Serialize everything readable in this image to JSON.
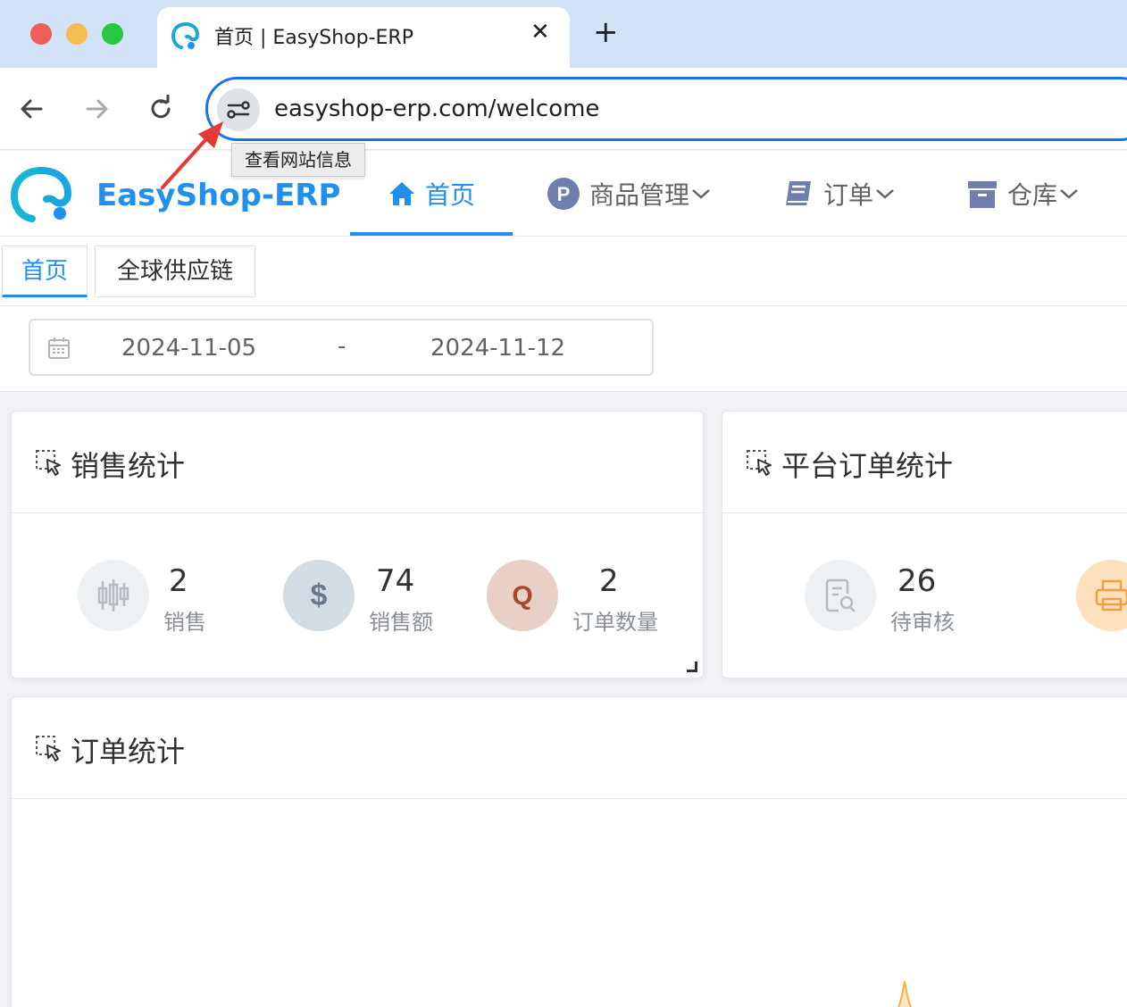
{
  "browser": {
    "tab_title": "首页 | EasyShop-ERP",
    "tab_close": "✕",
    "new_tab": "+",
    "url": "easyshop-erp.com/welcome",
    "tooltip": "查看网站信息"
  },
  "app": {
    "brand": "EasyShop-ERP",
    "menu": [
      {
        "label": "首页",
        "icon": "home-icon",
        "active": true
      },
      {
        "label": "商品管理",
        "icon": "p-circle-icon",
        "dropdown": true
      },
      {
        "label": "订单",
        "icon": "book-icon",
        "dropdown": true
      },
      {
        "label": "仓库",
        "icon": "archive-box-icon",
        "dropdown": true
      }
    ],
    "tags": [
      {
        "label": "首页",
        "active": true
      },
      {
        "label": "全球供应链",
        "active": false
      }
    ]
  },
  "filter": {
    "start_date": "2024-11-05",
    "separator": "-",
    "end_date": "2024-11-12"
  },
  "cards": {
    "sales": {
      "title": "销售统计",
      "stats": [
        {
          "value": "2",
          "label": "销售",
          "icon": "candlestick-icon",
          "color": "#eef1f4"
        },
        {
          "value": "74",
          "label": "销售额",
          "icon": "dollar-icon",
          "color": "#d3dce3"
        },
        {
          "value": "2",
          "label": "订单数量",
          "icon": "q-icon",
          "color": "#e8d0c8"
        }
      ]
    },
    "platform": {
      "title": "平台订单统计",
      "stats": [
        {
          "value": "26",
          "label": "待审核",
          "icon": "document-search-icon",
          "color": "#eef1f4"
        },
        {
          "icon": "printer-icon",
          "color": "#fde0bd"
        }
      ]
    },
    "orders": {
      "title": "订单统计"
    }
  },
  "colors": {
    "primary": "#1f8ff0",
    "omnibox_border": "#1a73e8",
    "annotation_arrow": "#e53935"
  }
}
